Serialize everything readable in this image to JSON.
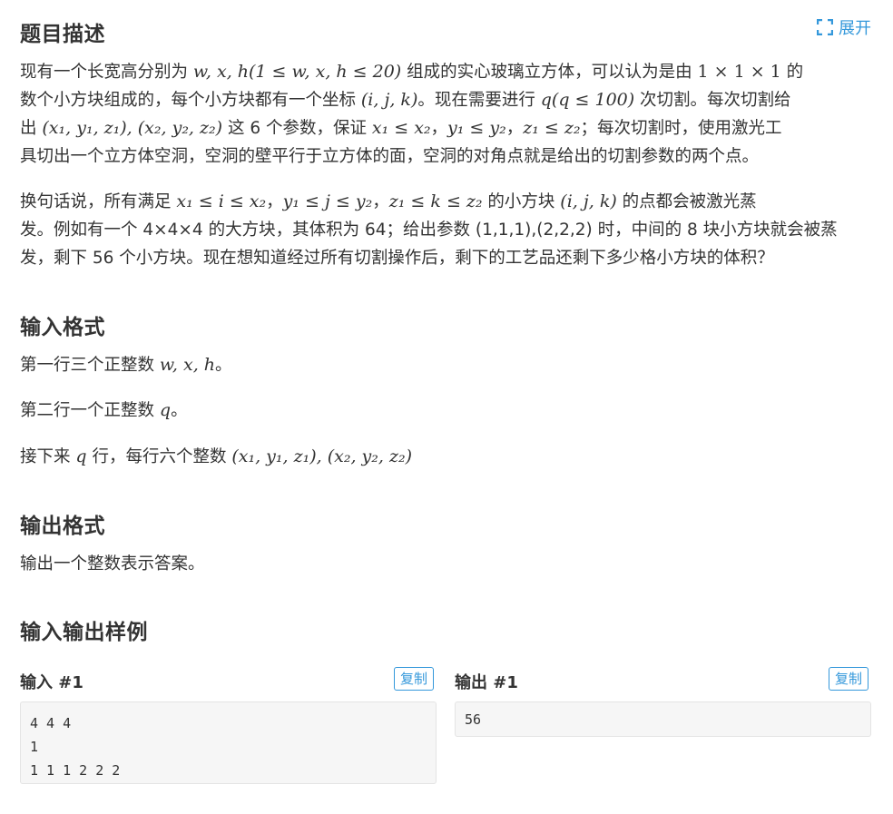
{
  "headings": {
    "description": "题目描述",
    "input_format": "输入格式",
    "output_format": "输出格式",
    "samples": "输入输出样例"
  },
  "expand": {
    "label": "展开",
    "icon": "expand-icon"
  },
  "description": {
    "p1_l1_a": "现有一个长宽高分别为 ",
    "p1_l1_math": "w, x, h(1 ≤ w, x, h ≤ 20)",
    "p1_l1_b": " 组成的实心玻璃立方体，可以认为是由 ",
    "p1_l1_math2": "1 × 1 × 1",
    "p1_l1_c": " 的",
    "p1_l2_a": "数个小方块组成的，每个小方块都有一个坐标 ",
    "p1_l2_math": "(i, j, k)",
    "p1_l2_b": "。现在需要进行 ",
    "p1_l2_math2": "q(q ≤ 100)",
    "p1_l2_c": " 次切割。每次切割给",
    "p1_l3_a": "出 ",
    "p1_l3_math": "(x₁, y₁, z₁), (x₂, y₂, z₂)",
    "p1_l3_b": " 这 6 个参数，保证 ",
    "p1_l3_math2": "x₁ ≤ x₂",
    "p1_l3_c": "，",
    "p1_l3_math3": "y₁ ≤ y₂",
    "p1_l3_d": "，",
    "p1_l3_math4": "z₁ ≤ z₂",
    "p1_l3_e": "；每次切割时，使用激光工",
    "p1_l4": "具切出一个立方体空洞，空洞的壁平行于立方体的面，空洞的对角点就是给出的切割参数的两个点。",
    "p2_l1_a": "换句话说，所有满足 ",
    "p2_l1_math": "x₁ ≤ i ≤ x₂",
    "p2_l1_b": "，",
    "p2_l1_math2": "y₁ ≤ j ≤ y₂",
    "p2_l1_c": "，",
    "p2_l1_math3": "z₁ ≤ k ≤ z₂",
    "p2_l1_d": " 的小方块 ",
    "p2_l1_math4": "(i, j, k)",
    "p2_l1_e": " 的点都会被激光蒸",
    "p2_l2": "发。例如有一个 4×4×4 的大方块，其体积为 64；给出参数 (1,1,1),(2,2,2) 时，中间的 8 块小方块就会被蒸",
    "p2_l3": "发，剩下 56 个小方块。现在想知道经过所有切割操作后，剩下的工艺品还剩下多少格小方块的体积？"
  },
  "input_format": {
    "l1_a": "第一行三个正整数 ",
    "l1_math": "w, x, h",
    "l1_b": "。",
    "l2_a": "第二行一个正整数 ",
    "l2_math": "q",
    "l2_b": "。",
    "l3_a": "接下来 ",
    "l3_math": "q",
    "l3_b": " 行，每行六个整数 ",
    "l3_math2": "(x₁, y₁, z₁), (x₂, y₂, z₂)"
  },
  "output_format": {
    "text": "输出一个整数表示答案。"
  },
  "samples": {
    "input_label": "输入 #1",
    "output_label": "输出 #1",
    "copy_label": "复制",
    "input_text": "4 4 4\n1\n1 1 1 2 2 2",
    "output_text": "56"
  }
}
